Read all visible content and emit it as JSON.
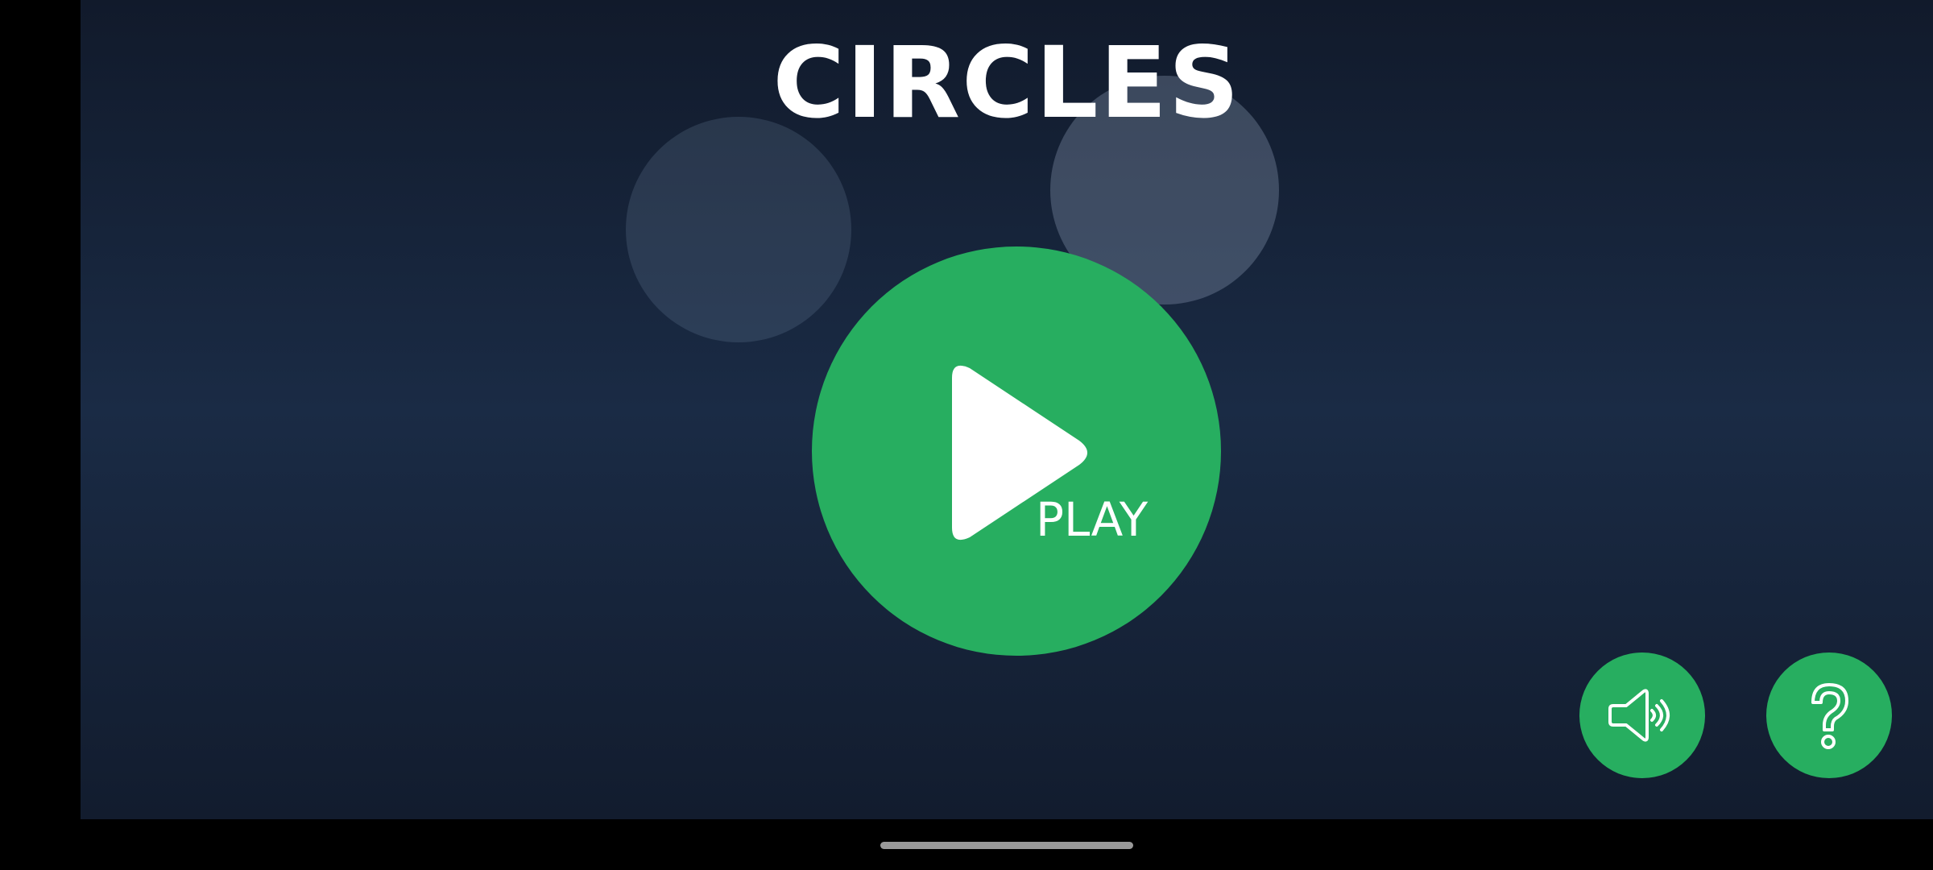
{
  "game": {
    "title": "CIRCLES",
    "play_label": "PLAY"
  },
  "buttons": {
    "play_icon": "play-icon",
    "sound_icon": "speaker-icon",
    "help_icon": "question-mark-icon"
  },
  "colors": {
    "background_top": "#111a2b",
    "background_mid": "#1a2b45",
    "accent_green": "#27ae60",
    "text": "#ffffff"
  }
}
